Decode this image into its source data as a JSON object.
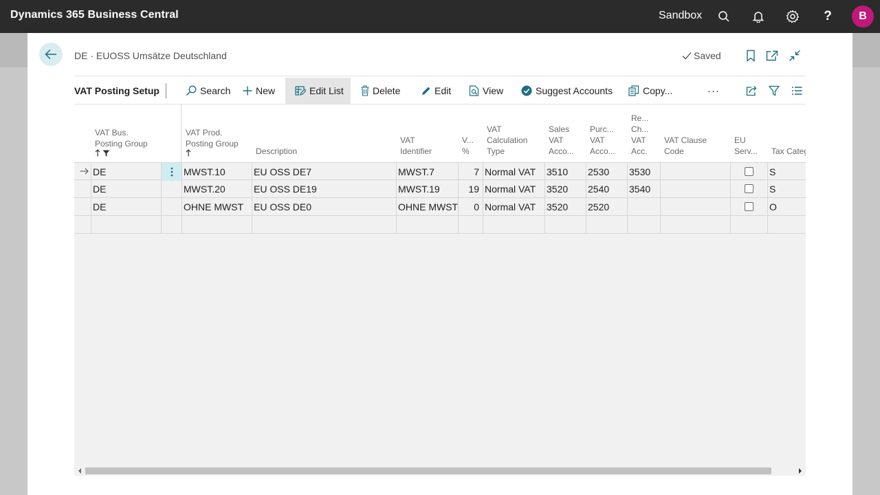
{
  "appbar": {
    "title": "Dynamics 365 Business Central",
    "environment": "Sandbox",
    "avatar_initial": "B",
    "avatar_color": "#c2187a"
  },
  "page": {
    "caption": "DE · EUOSS Umsätze Deutschland",
    "status": "Saved"
  },
  "actions": {
    "page_name": "VAT Posting Setup",
    "search": "Search",
    "new": "New",
    "edit_list": "Edit List",
    "delete": "Delete",
    "edit": "Edit",
    "view": "View",
    "suggest_accounts": "Suggest Accounts",
    "copy": "Copy...",
    "more": "···"
  },
  "columns": {
    "bus_group": [
      "VAT Bus.",
      "Posting Group"
    ],
    "prod_group": [
      "VAT Prod.",
      "Posting Group"
    ],
    "description": "Description",
    "vat_identifier": [
      "VAT",
      "Identifier"
    ],
    "vat_pct": [
      "V...",
      "%"
    ],
    "calc_type": [
      "VAT",
      "Calculation",
      "Type"
    ],
    "sales_acc": [
      "Sales",
      "VAT",
      "Acco..."
    ],
    "purch_acc": [
      "Purc...",
      "VAT",
      "Acco..."
    ],
    "rev_acc": [
      "Re...",
      "Ch...",
      "VAT",
      "Acc."
    ],
    "clause_code": [
      "VAT Clause",
      "Code"
    ],
    "eu_service": [
      "EU",
      "Serv..."
    ],
    "tax_category": "Tax Categ"
  },
  "rows": [
    {
      "bus": "DE",
      "prod": "MWST.10",
      "desc": "EU OSS DE7",
      "ident": "MWST.7",
      "pct": "7",
      "calc": "Normal VAT",
      "sales": "3510",
      "purch": "2530",
      "rev": "3530",
      "clause": "",
      "eu": false,
      "tax": "S"
    },
    {
      "bus": "DE",
      "prod": "MWST.20",
      "desc": "EU OSS DE19",
      "ident": "MWST.19",
      "pct": "19",
      "calc": "Normal VAT",
      "sales": "3520",
      "purch": "2540",
      "rev": "3540",
      "clause": "",
      "eu": false,
      "tax": "S"
    },
    {
      "bus": "DE",
      "prod": "OHNE MWST",
      "desc": "EU OSS DE0",
      "ident": "OHNE MWST",
      "pct": "0",
      "calc": "Normal VAT",
      "sales": "3520",
      "purch": "2520",
      "rev": "",
      "clause": "",
      "eu": false,
      "tax": "O"
    }
  ],
  "colors": {
    "accent": "#1c6f80",
    "appbar_bg": "#2b2b2b",
    "selected_cell": "#cfecf1"
  }
}
